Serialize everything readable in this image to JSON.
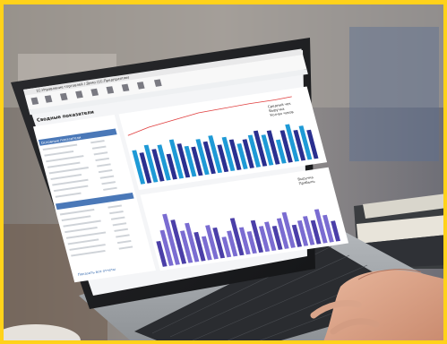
{
  "photo": {
    "subject": "laptop-with-dashboard",
    "frame_color": "#ffd21a"
  },
  "screen": {
    "window_title": "1С:Управление торговлей / Демо (1С:Предприятие)",
    "report_title": "Сводные показатели",
    "left_panel_header": "Основные показатели",
    "bottom_link": "Показать все отчеты",
    "legend_top": [
      "Средний чек",
      "Выручка",
      "Кол-во чеков"
    ],
    "legend_bottom": [
      "Выручка",
      "Прибыль"
    ],
    "accent_line_color": "#e04040",
    "bar_dark_color": "#2a2f8f",
    "bar_light_color": "#1e9ad6"
  }
}
